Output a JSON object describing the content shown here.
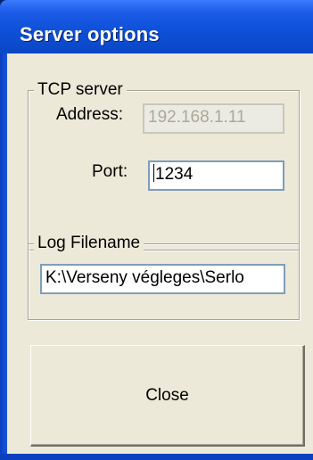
{
  "window": {
    "title": "Server options"
  },
  "tcp_server": {
    "caption": "TCP server",
    "address_label": "Address:",
    "address_value": "192.168.1.11",
    "address_enabled": false,
    "port_label": "Port:",
    "port_value": "1234"
  },
  "log": {
    "caption": "Log Filename",
    "filename_value": "K:\\Verseny végleges\\Serlo"
  },
  "buttons": {
    "close_label": "Close"
  },
  "colors": {
    "titlebar": "#0d4fd6",
    "client_background": "#ece9d8",
    "disabled_text": "#aca899"
  }
}
